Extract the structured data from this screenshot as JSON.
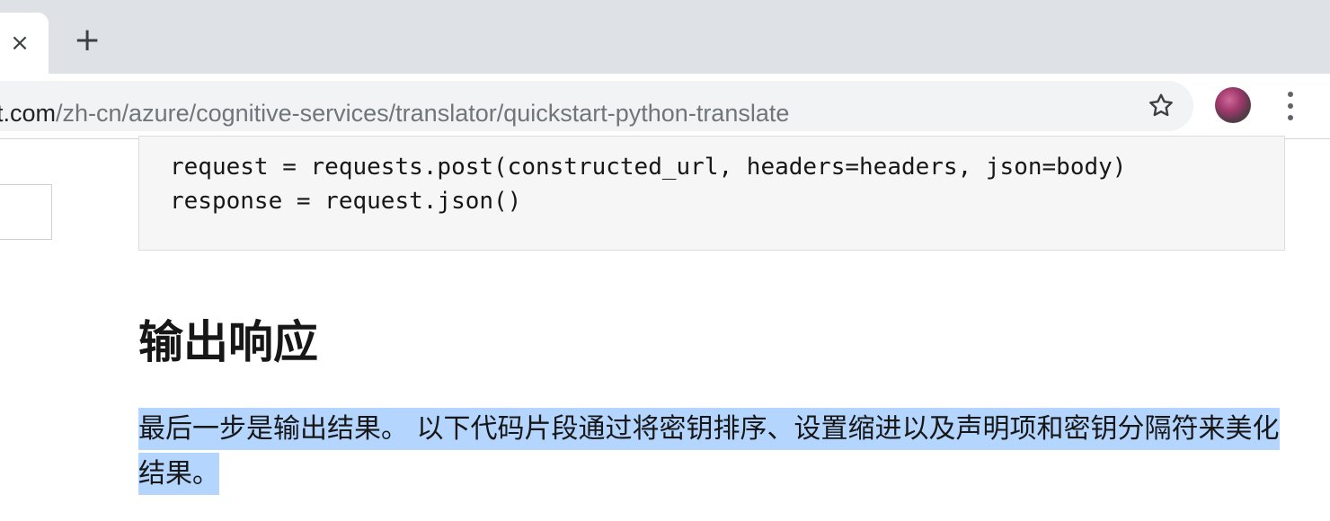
{
  "browser": {
    "tab_close_glyph": "×",
    "new_tab_glyph": "+",
    "url_host": "soft.com",
    "url_path": "/zh-cn/azure/cognitive-services/translator/quickstart-python-translate",
    "bookmark_icon": "star-icon",
    "menu_icon": "vertical-dots-icon"
  },
  "code": {
    "lines": [
      "request = requests.post(constructed_url, headers=headers, json=body)",
      "response = request.json()"
    ]
  },
  "article": {
    "heading": "输出响应",
    "paragraph": "最后一步是输出结果。 以下代码片段通过将密钥排序、设置缩进以及声明项和密钥分隔符来美化结果。",
    "selection_color": "#b4d5fe"
  }
}
